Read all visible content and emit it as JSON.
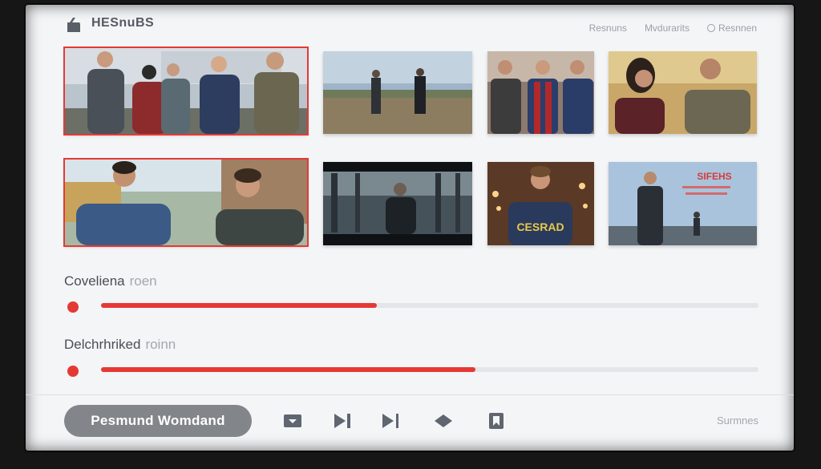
{
  "header": {
    "title": "HESnuBS",
    "logo_icon": "app-logo-icon",
    "nav": [
      "Resnuns",
      "Mvdurarits",
      "Resnnen"
    ]
  },
  "grid": {
    "rows": [
      {
        "items": [
          {
            "name": "group-of-five-young-men",
            "selected": true
          },
          {
            "name": "two-figures-in-field",
            "selected": false
          },
          {
            "name": "three-young-men",
            "selected": false
          },
          {
            "name": "woman-and-man-warm-light",
            "selected": false
          }
        ]
      },
      {
        "items": [
          {
            "name": "two-young-men-street",
            "selected": true
          },
          {
            "name": "dark-forest-figure",
            "selected": false
          },
          {
            "name": "man-in-cesrad-jacket",
            "selected": false
          },
          {
            "name": "man-outdoors-sky-text",
            "selected": false
          }
        ]
      }
    ],
    "overlay_texts": {
      "jacket": "CESRAD",
      "sky_title": "SIFEHS"
    }
  },
  "progress": [
    {
      "label": "Coveliena",
      "sub": "roen",
      "value_percent": 42
    },
    {
      "label": "Delchrhriked",
      "sub": "roinn",
      "value_percent": 57
    }
  ],
  "footer": {
    "primary_button": "Pesmund Womdand",
    "controls": [
      "dropdown-icon",
      "next-track-icon",
      "skip-next-icon",
      "diamond-icon",
      "bookmark-icon"
    ],
    "right_text": "Surmnes"
  },
  "colors": {
    "accent": "#e53935",
    "screen_bg": "#f4f5f7",
    "pill_bg": "#828589"
  }
}
